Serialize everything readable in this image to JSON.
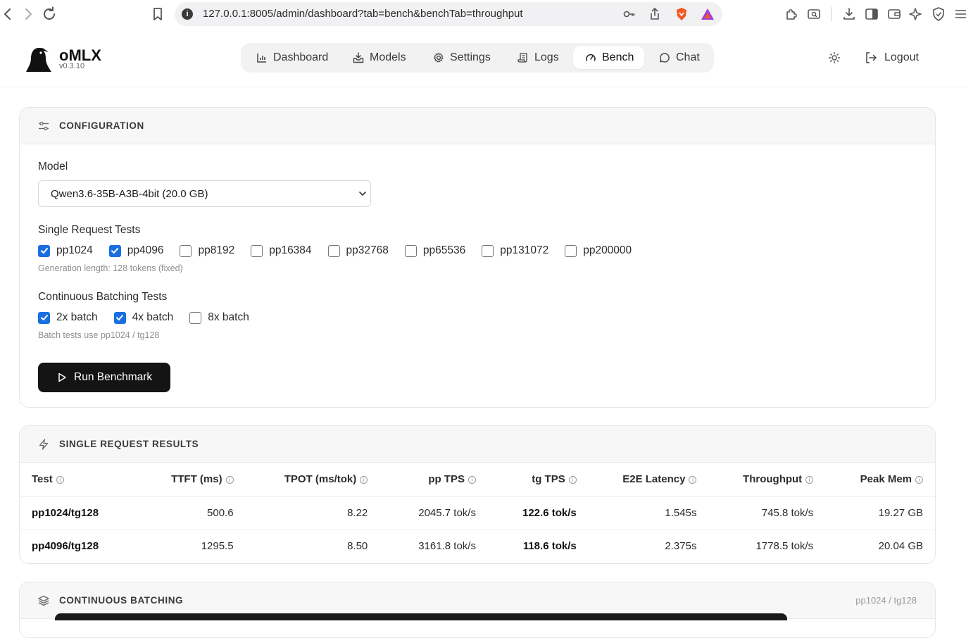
{
  "browser": {
    "url": "127.0.0.1:8005/admin/dashboard?tab=bench&benchTab=throughput"
  },
  "app": {
    "brand": "oMLX",
    "version": "v0.3.10"
  },
  "nav": {
    "items": [
      {
        "label": "Dashboard",
        "icon": "bar-chart-icon"
      },
      {
        "label": "Models",
        "icon": "download-tray-icon"
      },
      {
        "label": "Settings",
        "icon": "gear-icon"
      },
      {
        "label": "Logs",
        "icon": "scroll-icon"
      },
      {
        "label": "Bench",
        "icon": "gauge-icon",
        "active": true
      },
      {
        "label": "Chat",
        "icon": "chat-bubble-icon"
      }
    ],
    "logout": "Logout"
  },
  "config": {
    "title": "CONFIGURATION",
    "model_label": "Model",
    "model_value": "Qwen3.6-35B-A3B-4bit (20.0 GB)",
    "single_label": "Single Request Tests",
    "single_tests": [
      {
        "label": "pp1024",
        "checked": true
      },
      {
        "label": "pp4096",
        "checked": true
      },
      {
        "label": "pp8192",
        "checked": false
      },
      {
        "label": "pp16384",
        "checked": false
      },
      {
        "label": "pp32768",
        "checked": false
      },
      {
        "label": "pp65536",
        "checked": false
      },
      {
        "label": "pp131072",
        "checked": false
      },
      {
        "label": "pp200000",
        "checked": false
      }
    ],
    "single_hint": "Generation length: 128 tokens (fixed)",
    "batch_label": "Continuous Batching Tests",
    "batch_tests": [
      {
        "label": "2x batch",
        "checked": true
      },
      {
        "label": "4x batch",
        "checked": true
      },
      {
        "label": "8x batch",
        "checked": false
      }
    ],
    "batch_hint": "Batch tests use pp1024 / tg128",
    "run_label": "Run Benchmark"
  },
  "results": {
    "title": "SINGLE REQUEST RESULTS",
    "headers": [
      "Test",
      "TTFT (ms)",
      "TPOT (ms/tok)",
      "pp TPS",
      "tg TPS",
      "E2E Latency",
      "Throughput",
      "Peak Mem"
    ],
    "rows": [
      [
        "pp1024/tg128",
        "500.6",
        "8.22",
        "2045.7 tok/s",
        "122.6 tok/s",
        "1.545s",
        "745.8 tok/s",
        "19.27 GB"
      ],
      [
        "pp4096/tg128",
        "1295.5",
        "8.50",
        "3161.8 tok/s",
        "118.6 tok/s",
        "2.375s",
        "1778.5 tok/s",
        "20.04 GB"
      ]
    ]
  },
  "batching": {
    "title": "CONTINUOUS BATCHING",
    "note": "pp1024 / tg128"
  },
  "colors": {
    "checkbox": "#1a6fe0",
    "button": "#141414"
  }
}
